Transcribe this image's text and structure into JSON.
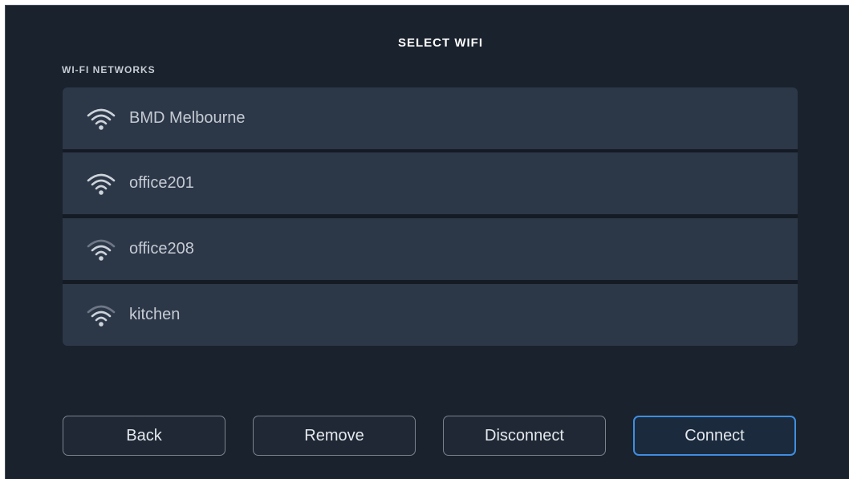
{
  "header": {
    "title": "SELECT WIFI"
  },
  "networks_section": {
    "label": "WI-FI NETWORKS",
    "items": [
      {
        "name": "BMD Melbourne",
        "signal": "strong",
        "icon": "wifi-icon"
      },
      {
        "name": "office201",
        "signal": "strong",
        "icon": "wifi-icon"
      },
      {
        "name": "office208",
        "signal": "medium",
        "icon": "wifi-icon"
      },
      {
        "name": "kitchen",
        "signal": "medium",
        "icon": "wifi-icon"
      }
    ]
  },
  "buttons": {
    "back": "Back",
    "remove": "Remove",
    "disconnect": "Disconnect",
    "connect": "Connect"
  },
  "colors": {
    "background": "#1a222d",
    "list_item": "#2c3748",
    "accent": "#3f8ee0"
  }
}
